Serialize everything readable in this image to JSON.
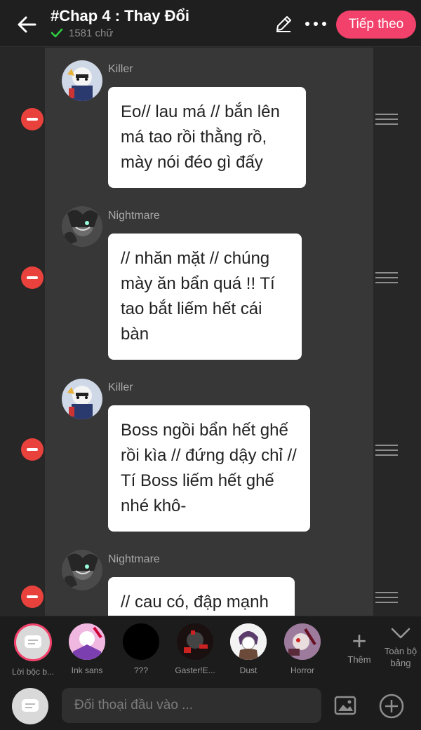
{
  "header": {
    "title": "#Chap 4 : Thay Đổi",
    "word_count": "1581 chữ",
    "next_label": "Tiếp theo"
  },
  "messages": [
    {
      "speaker": "Killer",
      "text": "Eo// lau má // bắn lên má tao rồi thằng rồ, mày nói đéo gì đấy"
    },
    {
      "speaker": "Nightmare",
      "text": "// nhăn mặt // chúng mày ăn bẩn quá !! Tí tao bắt liếm hết cái bàn"
    },
    {
      "speaker": "Killer",
      "text": "Boss ngồi bẩn hết ghế rồi kìa // đứng dậy chỉ // Tí Boss liếm hết ghế nhé khô-"
    },
    {
      "speaker": "Nightmare",
      "text": "// cau có, đập mạnh"
    }
  ],
  "characters": [
    {
      "label": "Lời bộc b..."
    },
    {
      "label": "Ink sans"
    },
    {
      "label": "???"
    },
    {
      "label": "Gaster!E..."
    },
    {
      "label": "Dust"
    },
    {
      "label": "Horror"
    }
  ],
  "toolbar": {
    "add_label": "Thêm",
    "expand_label": "Toàn bộ bảng"
  },
  "input": {
    "placeholder": "Đối thoại đầu vào ..."
  },
  "colors": {
    "accent": "#f2416b",
    "remove": "#e9423d",
    "check": "#2ecc40"
  },
  "icons": {
    "back": "arrow-left-icon",
    "edit": "pen-icon",
    "more": "more-dots-icon",
    "remove": "minus-circle-icon",
    "drag": "drag-handle-icon",
    "image": "image-icon",
    "add": "plus-circle-icon"
  }
}
